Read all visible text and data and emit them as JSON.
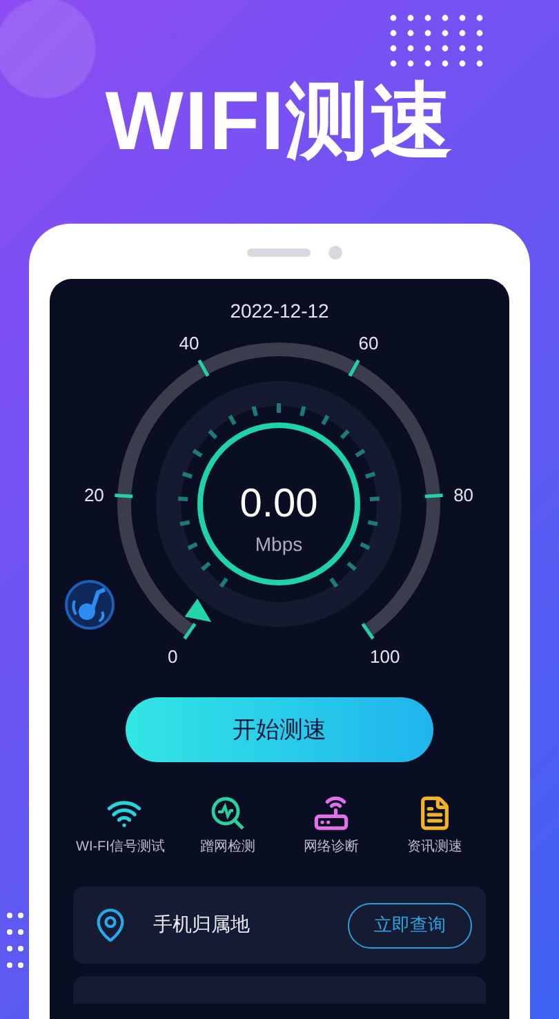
{
  "headline": "WIFI测速",
  "screen": {
    "date": "2022-12-12",
    "gauge": {
      "reading": "0.00",
      "unit": "Mbps",
      "scale": [
        "0",
        "20",
        "40",
        "60",
        "80",
        "100"
      ]
    },
    "start_button": "开始测速",
    "tools": [
      {
        "label": "WI-FI信号测试",
        "kind": "wifi",
        "color": "#26d4dc"
      },
      {
        "label": "蹭网检测",
        "kind": "scan",
        "color": "#2bd19a"
      },
      {
        "label": "网络诊断",
        "kind": "router",
        "color": "#e071e6"
      },
      {
        "label": "资讯测速",
        "kind": "doc",
        "color": "#f2b326"
      }
    ],
    "location_card": {
      "title": "手机归属地",
      "button": "立即查询"
    }
  }
}
